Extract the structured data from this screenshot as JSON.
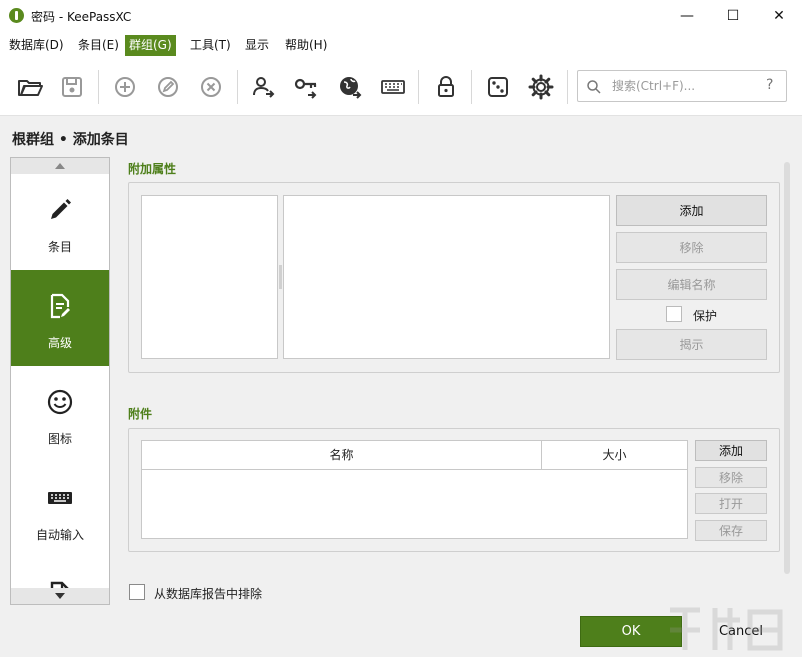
{
  "window": {
    "title": "密码 - KeePassXC",
    "minimize_glyph": "—",
    "maximize_glyph": "☐",
    "close_glyph": "✕"
  },
  "menu": [
    {
      "label": "数据库(D)"
    },
    {
      "label": "条目(E)"
    },
    {
      "label": "群组(G)",
      "active": true
    },
    {
      "label": "工具(T)"
    },
    {
      "label": "显示"
    },
    {
      "label": "帮助(H)"
    }
  ],
  "toolbar": {
    "icons": [
      "folder-open-icon",
      "save-icon",
      "add-entry-icon",
      "edit-entry-icon",
      "delete-entry-icon",
      "copy-username-icon",
      "copy-password-icon",
      "open-url-icon",
      "auto-type-icon",
      "lock-icon",
      "password-generator-icon",
      "settings-icon"
    ],
    "search_placeholder": "搜索(Ctrl+F)...",
    "help_glyph": "?"
  },
  "breadcrumb": "根群组 • 添加条目",
  "categories": [
    {
      "label": "条目",
      "icon": "pencil-icon"
    },
    {
      "label": "高级",
      "icon": "document-edit-icon",
      "selected": true
    },
    {
      "label": "图标",
      "icon": "smiley-icon"
    },
    {
      "label": "自动输入",
      "icon": "keyboard-icon"
    },
    {
      "label": "",
      "icon": "document-icon"
    }
  ],
  "attributes": {
    "title": "附加属性",
    "add": "添加",
    "remove": "移除",
    "rename": "编辑名称",
    "protect": "保护",
    "reveal": "揭示"
  },
  "attachments": {
    "title": "附件",
    "col_name": "名称",
    "col_size": "大小",
    "add": "添加",
    "remove": "移除",
    "open": "打开",
    "save": "保存"
  },
  "exclude_label": "从数据库报告中排除",
  "ok": "OK",
  "cancel": "Cancel",
  "colors": {
    "accent": "#4e7f1b",
    "menu_active": "#5a8a1e"
  }
}
